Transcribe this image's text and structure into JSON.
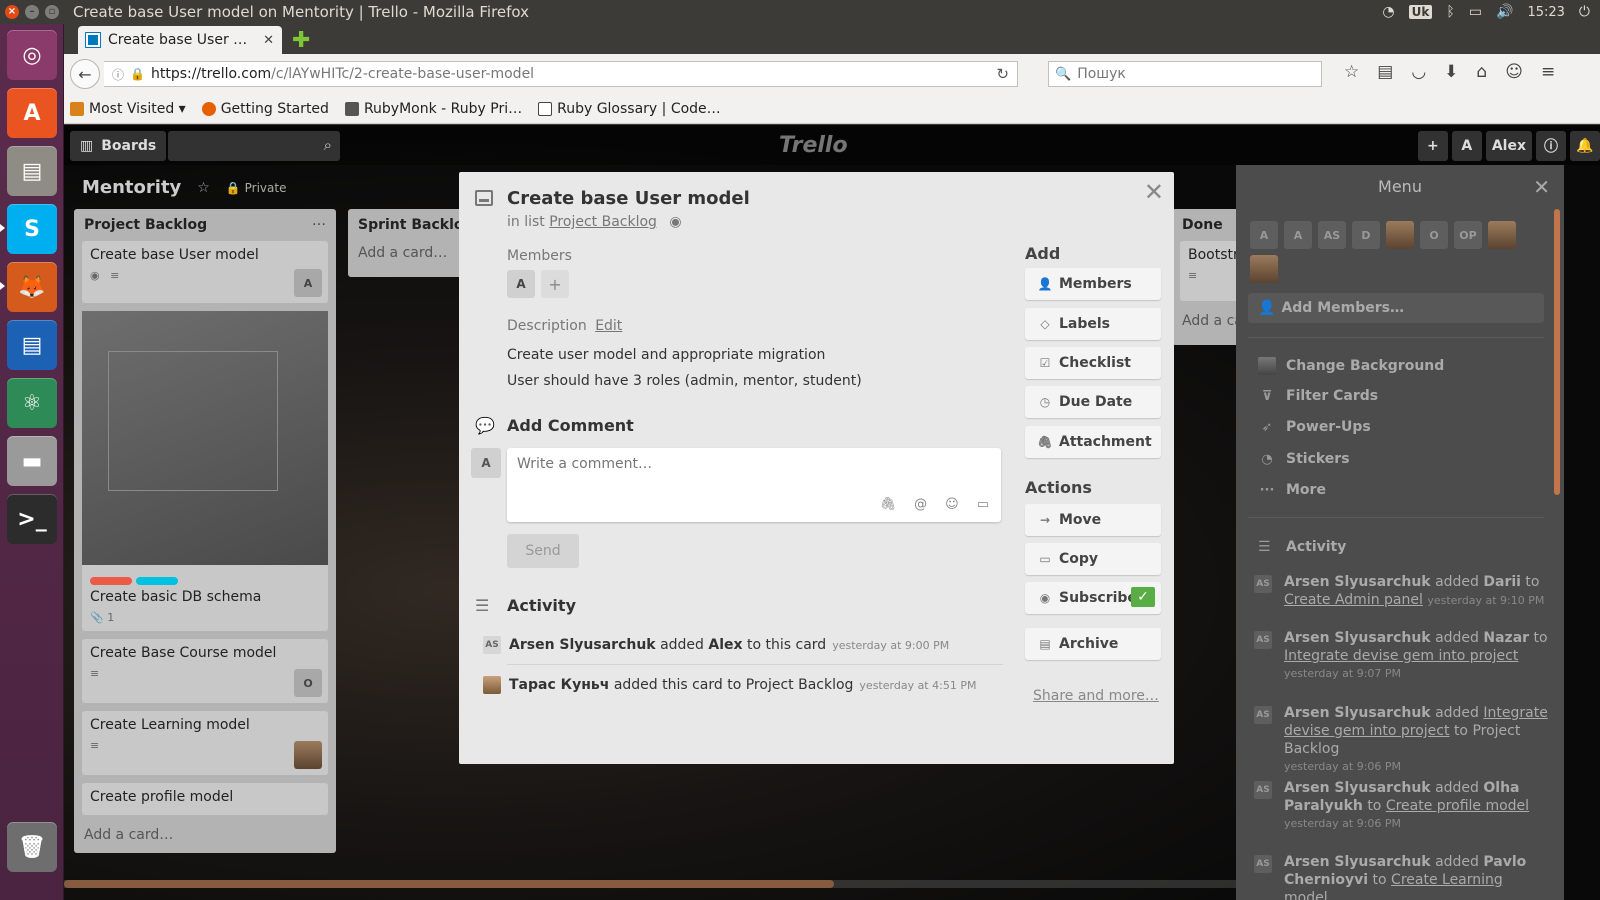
{
  "os": {
    "window_title": "Create base User model on Mentority | Trello - Mozilla Firefox",
    "keyboard_layout": "Uk",
    "clock": "15:23"
  },
  "launcher": {
    "apps": [
      "ubuntu-dash",
      "software-center",
      "files",
      "skype",
      "firefox",
      "libreoffice-writer",
      "atom",
      "disk",
      "terminal",
      "trash"
    ]
  },
  "browser": {
    "tab_title": "Create base User m…",
    "url_host": "https://trello.com",
    "url_path": "/c/lAYwHITc/2-create-base-user-model",
    "search_placeholder": "Пошук",
    "bookmarks": [
      {
        "label": "Most Visited ▾",
        "icon": "folder-icon",
        "color": "#d9821c"
      },
      {
        "label": "Getting Started",
        "icon": "firefox-icon",
        "color": "#e66000"
      },
      {
        "label": "RubyMonk - Ruby Pri…",
        "icon": "rubymonk-icon",
        "color": "#555555"
      },
      {
        "label": "Ruby Glossary | Code…",
        "icon": "page-icon",
        "color": "#444444"
      }
    ]
  },
  "trello": {
    "header": {
      "boards_label": "Boards",
      "logo": "Trello",
      "user_initial": "A",
      "user_name": "Alex"
    },
    "board": {
      "name": "Mentority",
      "visibility": "Private"
    },
    "lists": [
      {
        "title": "Project Backlog",
        "cards": [
          {
            "title": "Create base User model",
            "member": "A"
          },
          {
            "title": "Create basic DB schema",
            "attachments": "1"
          },
          {
            "title": "Create Base Course model",
            "member": "O"
          },
          {
            "title": "Create Learning model"
          },
          {
            "title": "Create profile model"
          }
        ],
        "add_card": "Add a card…"
      },
      {
        "title": "Sprint Backlog",
        "add_card": "Add a card…"
      },
      {
        "title": "Done",
        "cards": [
          {
            "title": "Bootstra"
          }
        ],
        "add_card": "Add a ca"
      }
    ],
    "label_colors": [
      "#eb5a46",
      "#00c2e0"
    ]
  },
  "modal": {
    "title": "Create base User model",
    "in_list_prefix": "in list",
    "list_name": "Project Backlog",
    "members_label": "Members",
    "member_initial": "A",
    "description_label": "Description",
    "edit_label": "Edit",
    "description_lines": [
      "Create user model and appropriate migration",
      "User should have 3 roles (admin, mentor, student)"
    ],
    "add_comment_title": "Add Comment",
    "commenter_initial": "A",
    "comment_placeholder": "Write a comment…",
    "send_label": "Send",
    "activity_title": "Activity",
    "activity": [
      {
        "avatar": "AS",
        "user": "Arsen Slyusarchuk",
        "verb": "added",
        "target": "Alex",
        "rest": "to this card",
        "time": "yesterday at 9:00 PM"
      },
      {
        "avatar": "",
        "user": "Тарас Куньч",
        "verb": "added this card to Project Backlog",
        "target": "",
        "rest": "",
        "time": "yesterday at 4:51 PM"
      }
    ],
    "sidebar": {
      "add_title": "Add",
      "add_buttons": [
        "Members",
        "Labels",
        "Checklist",
        "Due Date",
        "Attachment"
      ],
      "actions_title": "Actions",
      "action_buttons": [
        "Move",
        "Copy",
        "Subscribe",
        "Archive"
      ],
      "share_label": "Share and more…"
    }
  },
  "menu": {
    "title": "Menu",
    "members": [
      "A",
      "A",
      "AS",
      "D",
      "photo",
      "O",
      "OP",
      "photo",
      "photo"
    ],
    "add_members": "Add Members…",
    "items": [
      "Change Background",
      "Filter Cards",
      "Power-Ups",
      "Stickers",
      "More"
    ],
    "activity_title": "Activity",
    "activity": [
      {
        "user": "Arsen Slyusarchuk",
        "verb": "added",
        "object": "Darii",
        "mid": "to",
        "link": "Create Admin panel",
        "tail": "",
        "time": "yesterday at 9:10 PM"
      },
      {
        "user": "Arsen Slyusarchuk",
        "verb": "added",
        "object": "Nazar",
        "mid": "to",
        "link": "Integrate devise gem into project",
        "tail": "",
        "time": "yesterday at 9:07 PM"
      },
      {
        "user": "Arsen Slyusarchuk",
        "verb": "added",
        "object": "",
        "mid": "",
        "link": "Integrate devise gem into project",
        "tail": "to Project Backlog",
        "time": "yesterday at 9:06 PM"
      },
      {
        "user": "Arsen Slyusarchuk",
        "verb": "added",
        "object": "Olha Paralyukh",
        "mid": "to",
        "link": "Create profile model",
        "tail": "",
        "time": "yesterday at 9:06 PM"
      },
      {
        "user": "Arsen Slyusarchuk",
        "verb": "added",
        "object": "Pavlo Chernioyvi",
        "mid": "to",
        "link": "Create Learning model",
        "tail": "",
        "time": ""
      }
    ]
  }
}
